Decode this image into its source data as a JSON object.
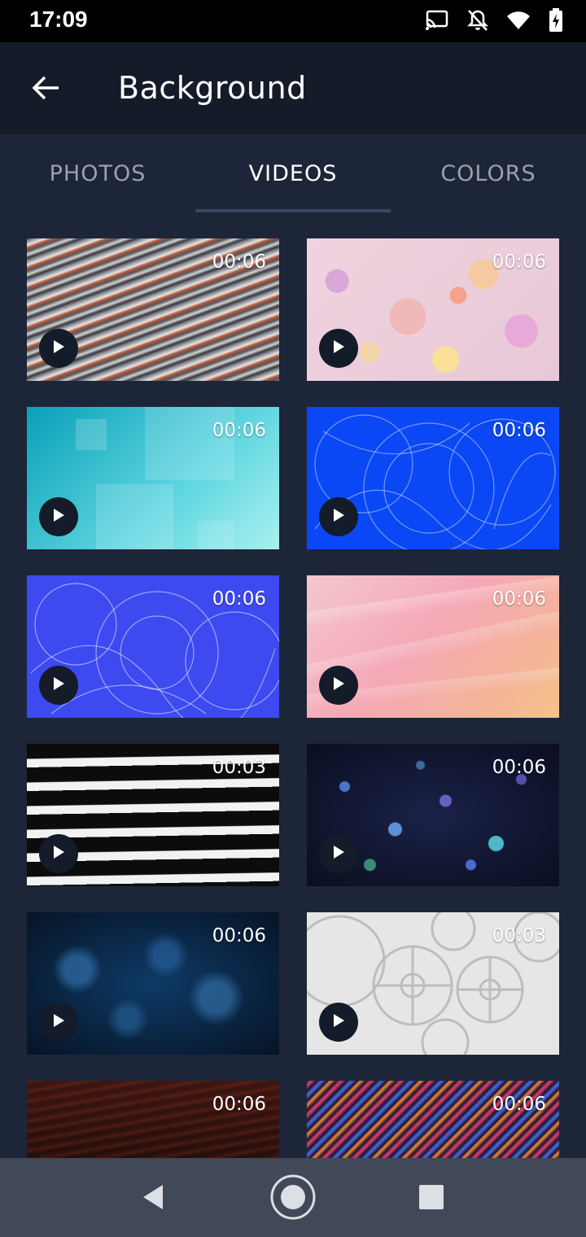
{
  "status_bar": {
    "time": "17:09",
    "icons": [
      "cast-icon",
      "bell-off-icon",
      "wifi-icon",
      "battery-charging-icon"
    ]
  },
  "app_bar": {
    "title": "Background",
    "back_icon": "arrow-left-icon"
  },
  "tabs": [
    {
      "label": "PHOTOS",
      "selected": false
    },
    {
      "label": "VIDEOS",
      "selected": true
    },
    {
      "label": "COLORS",
      "selected": false
    }
  ],
  "videos": [
    {
      "duration": "00:06",
      "theme": "metallic-stripes"
    },
    {
      "duration": "00:06",
      "theme": "pastel-balls"
    },
    {
      "duration": "00:06",
      "theme": "cyan-squares"
    },
    {
      "duration": "00:06",
      "theme": "blue-wires"
    },
    {
      "duration": "00:06",
      "theme": "indigo-wires"
    },
    {
      "duration": "00:06",
      "theme": "peach-folds"
    },
    {
      "duration": "00:03",
      "theme": "zebra-stripes"
    },
    {
      "duration": "00:06",
      "theme": "dark-droplets"
    },
    {
      "duration": "00:06",
      "theme": "blue-bokeh"
    },
    {
      "duration": "00:03",
      "theme": "white-gears"
    },
    {
      "duration": "00:06",
      "theme": "red-waves"
    },
    {
      "duration": "00:06",
      "theme": "neon-streaks"
    }
  ],
  "nav_bar": {
    "icons": [
      "back-triangle-icon",
      "home-circle-icon",
      "recents-square-icon"
    ]
  },
  "colors": {
    "statusbar": "#000000",
    "appbar": "#141b29",
    "background": "#1d2638",
    "navbar": "#414958"
  }
}
